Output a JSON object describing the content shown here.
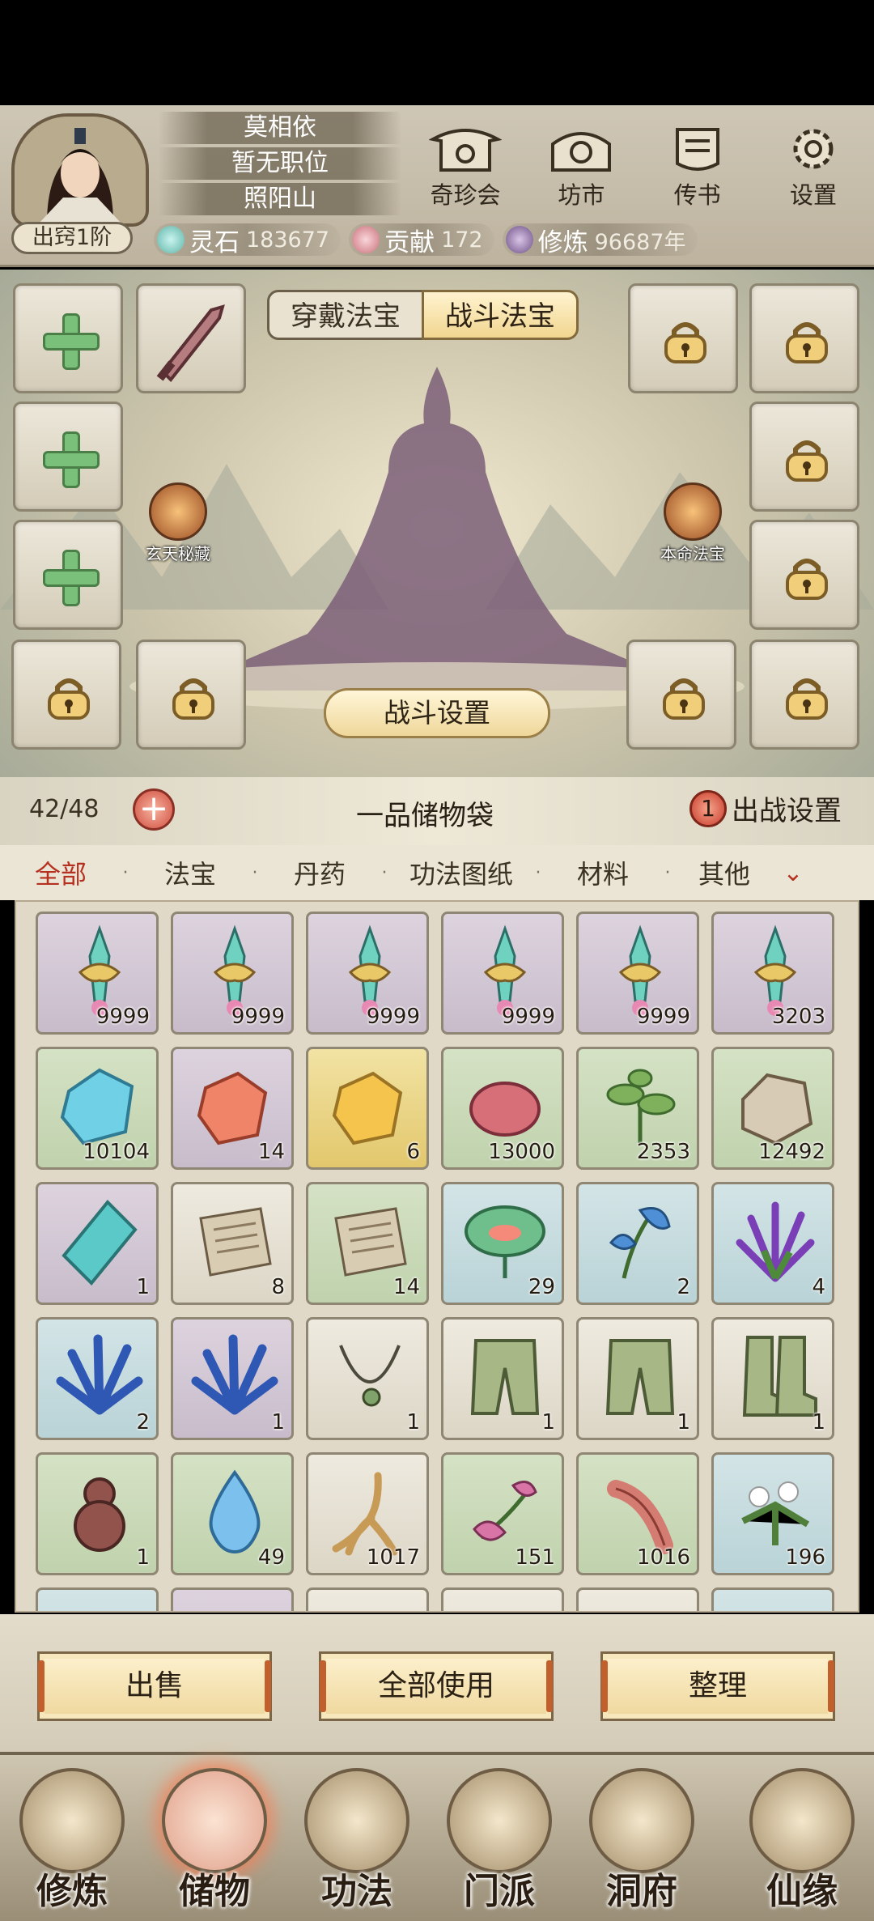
{
  "profile": {
    "name": "莫相依",
    "position": "暂无职位",
    "sect": "照阳山",
    "realm": "出窍1阶"
  },
  "top_menu": [
    {
      "label": "奇珍会",
      "icon": "treasure-pavilion-icon"
    },
    {
      "label": "坊市",
      "icon": "market-icon"
    },
    {
      "label": "传书",
      "icon": "scroll-letter-icon"
    },
    {
      "label": "设置",
      "icon": "gear-icon"
    }
  ],
  "resources": [
    {
      "label": "灵石",
      "value": "183677",
      "color": "#7fd3c8"
    },
    {
      "label": "贡献",
      "value": "172",
      "color": "#e5a0a8"
    },
    {
      "label": "修炼",
      "value": "96687年",
      "color": "#9a7bb0"
    }
  ],
  "equip_tabs": [
    {
      "label": "穿戴法宝",
      "active": false
    },
    {
      "label": "战斗法宝",
      "active": true
    }
  ],
  "side_badges": {
    "left": "玄天秘藏",
    "right": "本命法宝"
  },
  "battle_button": "战斗设置",
  "bag": {
    "capacity": "42/48",
    "title": "一品储物袋",
    "battle_count": "1",
    "battle_label": "出战设置"
  },
  "categories": [
    {
      "label": "全部",
      "active": true
    },
    {
      "label": "法宝",
      "active": false
    },
    {
      "label": "丹药",
      "active": false
    },
    {
      "label": "功法图纸",
      "active": false
    },
    {
      "label": "材料",
      "active": false
    },
    {
      "label": "其他",
      "active": false
    }
  ],
  "inventory": [
    {
      "icon": "jade-sword-icon",
      "qty": "9999",
      "bg": "purple"
    },
    {
      "icon": "jade-sword-icon",
      "qty": "9999",
      "bg": "purple"
    },
    {
      "icon": "jade-sword-icon",
      "qty": "9999",
      "bg": "purple"
    },
    {
      "icon": "jade-sword-icon",
      "qty": "9999",
      "bg": "purple"
    },
    {
      "icon": "jade-sword-icon",
      "qty": "9999",
      "bg": "purple"
    },
    {
      "icon": "jade-sword-icon",
      "qty": "3203",
      "bg": "purple"
    },
    {
      "icon": "blue-crystal-icon",
      "qty": "10104",
      "bg": "green"
    },
    {
      "icon": "red-crystal-icon",
      "qty": "14",
      "bg": "purple"
    },
    {
      "icon": "gold-crystal-icon",
      "qty": "6",
      "bg": "gold"
    },
    {
      "icon": "red-ore-icon",
      "qty": "13000",
      "bg": "green"
    },
    {
      "icon": "herb-sprout-icon",
      "qty": "2353",
      "bg": "green"
    },
    {
      "icon": "rock-ore-icon",
      "qty": "12492",
      "bg": "green"
    },
    {
      "icon": "cyan-shard-icon",
      "qty": "1",
      "bg": "purple"
    },
    {
      "icon": "paper-scroll-icon",
      "qty": "8",
      "bg": "plain"
    },
    {
      "icon": "paper-scroll-icon",
      "qty": "14",
      "bg": "green"
    },
    {
      "icon": "lotus-leaf-icon",
      "qty": "29",
      "bg": "blue"
    },
    {
      "icon": "blue-flower-icon",
      "qty": "2",
      "bg": "blue"
    },
    {
      "icon": "purple-grass-icon",
      "qty": "4",
      "bg": "blue"
    },
    {
      "icon": "blue-grass-icon",
      "qty": "2",
      "bg": "blue"
    },
    {
      "icon": "blue-grass-icon",
      "qty": "1",
      "bg": "purple"
    },
    {
      "icon": "necklace-icon",
      "qty": "1",
      "bg": "plain"
    },
    {
      "icon": "green-pants-icon",
      "qty": "1",
      "bg": "plain"
    },
    {
      "icon": "green-pants-icon",
      "qty": "1",
      "bg": "plain"
    },
    {
      "icon": "green-boots-icon",
      "qty": "1",
      "bg": "plain"
    },
    {
      "icon": "gourd-icon",
      "qty": "1",
      "bg": "green"
    },
    {
      "icon": "water-drop-icon",
      "qty": "49",
      "bg": "green"
    },
    {
      "icon": "ginseng-root-icon",
      "qty": "1017",
      "bg": "plain"
    },
    {
      "icon": "pink-herb-icon",
      "qty": "151",
      "bg": "green"
    },
    {
      "icon": "pink-root-icon",
      "qty": "1016",
      "bg": "green"
    },
    {
      "icon": "white-flower-icon",
      "qty": "196",
      "bg": "blue"
    },
    {
      "icon": "partial-item-icon",
      "qty": "",
      "bg": "blue"
    },
    {
      "icon": "partial-item-icon",
      "qty": "",
      "bg": "purple"
    },
    {
      "icon": "partial-item-icon",
      "qty": "",
      "bg": "plain"
    },
    {
      "icon": "partial-item-icon",
      "qty": "",
      "bg": "plain"
    },
    {
      "icon": "partial-item-icon",
      "qty": "",
      "bg": "plain"
    },
    {
      "icon": "partial-item-icon",
      "qty": "",
      "bg": "blue"
    }
  ],
  "actions": {
    "sell": "出售",
    "use_all": "全部使用",
    "sort": "整理"
  },
  "bottom_nav": [
    {
      "label": "修炼",
      "active": false
    },
    {
      "label": "储物",
      "active": true
    },
    {
      "label": "功法",
      "active": false
    },
    {
      "label": "门派",
      "active": false
    },
    {
      "label": "洞府",
      "active": false
    },
    {
      "label": "仙缘",
      "active": false
    }
  ],
  "colors": {
    "active_tab": "#b5301f",
    "slot_plus": "#7bc07a",
    "button_gold": "#efd79c"
  }
}
